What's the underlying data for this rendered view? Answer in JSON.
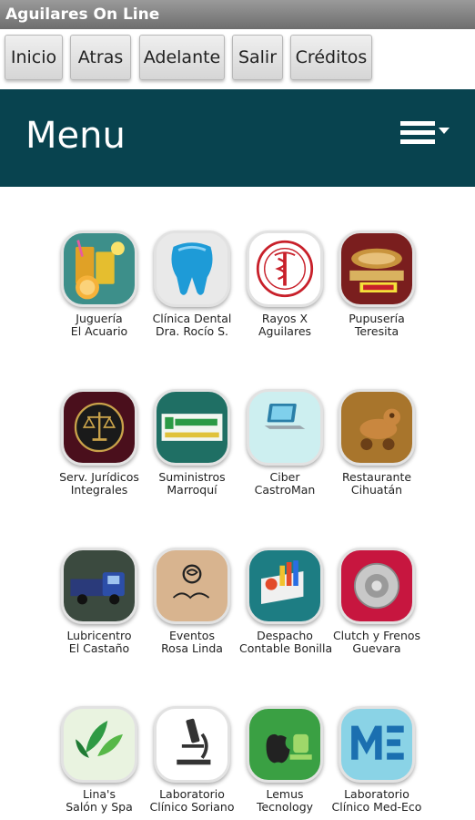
{
  "window": {
    "title": "Aguilares On Line"
  },
  "toolbar": {
    "buttons": [
      "Inicio",
      "Atras",
      "Adelante",
      "Salir",
      "Créditos"
    ]
  },
  "header": {
    "title": "Menu",
    "menu_icon": "hamburger-dropdown-icon"
  },
  "items": [
    {
      "line1": "Juguería",
      "line2": "El Acuario",
      "icon": "juice-icon",
      "color": "#3d8f8a"
    },
    {
      "line1": "Clínica Dental",
      "line2": "Dra. Rocío S.",
      "icon": "tooth-icon",
      "color": "#e9e9e9"
    },
    {
      "line1": "Rayos X",
      "line2": "Aguilares",
      "icon": "xray-logo-icon",
      "color": "#ffffff"
    },
    {
      "line1": "Pupusería",
      "line2": "Teresita",
      "icon": "pupuseria-logo-icon",
      "color": "#7a1e1e"
    },
    {
      "line1": "Serv. Jurídicos",
      "line2": "Integrales",
      "icon": "scales-of-justice-icon",
      "color": "#4a0f1c"
    },
    {
      "line1": "Suministros",
      "line2": "Marroquí",
      "icon": "suministros-logo-icon",
      "color": "#1f6f64"
    },
    {
      "line1": "Ciber",
      "line2": "CastroMan",
      "icon": "laptop-icon",
      "color": "#cdeff0"
    },
    {
      "line1": "Restaurante",
      "line2": "Cihuatán",
      "icon": "clay-dog-figure-icon",
      "color": "#a8752c"
    },
    {
      "line1": "Lubricentro",
      "line2": "El Castaño",
      "icon": "truck-icon",
      "color": "#3b4a3f"
    },
    {
      "line1": "Eventos",
      "line2": "Rosa Linda",
      "icon": "rose-logo-icon",
      "color": "#d8b48f"
    },
    {
      "line1": "Despacho",
      "line2": "Contable Bonilla",
      "icon": "office-supplies-icon",
      "color": "#1d7d83"
    },
    {
      "line1": "Clutch y Frenos",
      "line2": "Guevara",
      "icon": "brake-disc-icon",
      "color": "#c7163f"
    },
    {
      "line1": "Lina's",
      "line2": "Salón y Spa",
      "icon": "spa-leaves-icon",
      "color": "#e9f3e0"
    },
    {
      "line1": "Laboratorio",
      "line2": "Clínico Soriano",
      "icon": "microscope-icon",
      "color": "#ffffff"
    },
    {
      "line1": "Lemus",
      "line2": "Tecnology",
      "icon": "apple-android-icon",
      "color": "#3aa043"
    },
    {
      "line1": "Laboratorio",
      "line2": "Clínico Med-Eco",
      "icon": "med-eco-logo-icon",
      "color": "#8ad3e6"
    }
  ]
}
